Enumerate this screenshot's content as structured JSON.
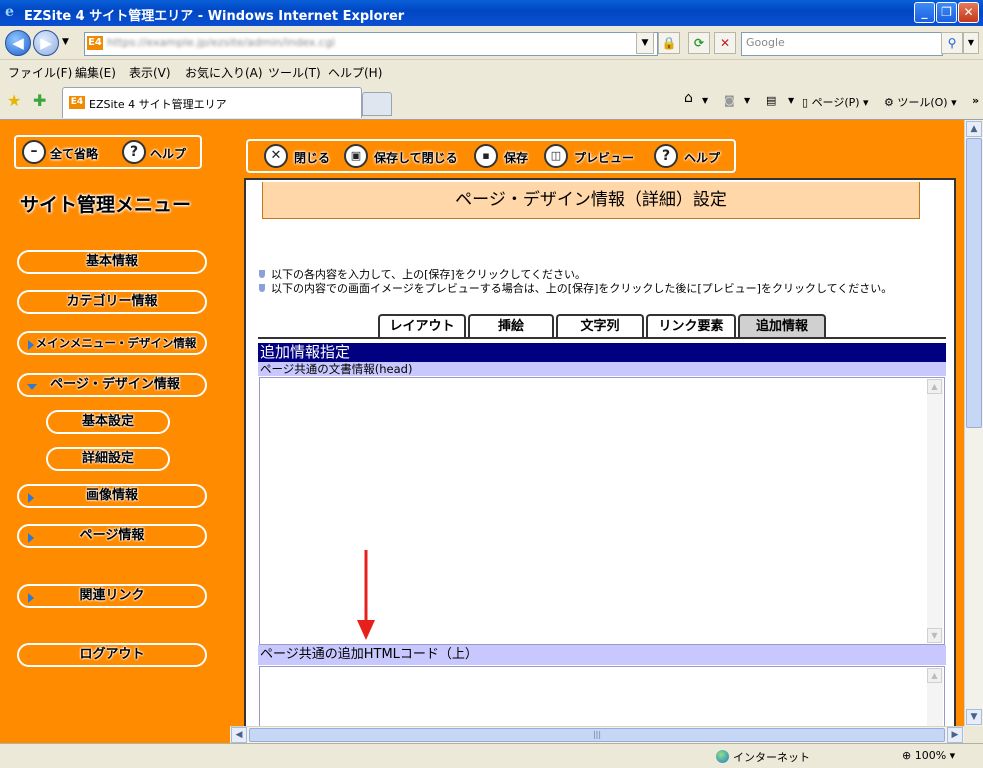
{
  "window": {
    "title": "EZSite 4 サイト管理エリア - Windows Internet Explorer",
    "minimize": "_",
    "restore": "❐",
    "close": "✕"
  },
  "addressbar": {
    "badge": "E4",
    "url": "https://example.jp/ezsite/admin/index.cgi",
    "search_placeholder": "Google"
  },
  "menubar": {
    "items": [
      "ファイル(F)",
      "編集(E)",
      "表示(V)",
      "お気に入り(A)",
      "ツール(T)",
      "ヘルプ(H)"
    ]
  },
  "tabbar": {
    "badge": "E4",
    "active_tab": "EZSite 4 サイト管理エリア",
    "page_cmd": "ページ(P)",
    "tools_cmd": "ツール(O)",
    "chevron": "»"
  },
  "sidebar": {
    "collapse_all": "全て省略",
    "help": "ヘルプ",
    "menu_title": "サイト管理メニュー",
    "items": [
      {
        "label": "基本情報"
      },
      {
        "label": "カテゴリー情報"
      },
      {
        "label": "メインメニュー・デザイン情報"
      },
      {
        "label": "ページ・デザイン情報"
      },
      {
        "label": "基本設定"
      },
      {
        "label": "詳細設定"
      },
      {
        "label": "画像情報"
      },
      {
        "label": "ページ情報"
      },
      {
        "label": "関連リンク"
      },
      {
        "label": "ログアウト"
      }
    ]
  },
  "toolbar": {
    "close": "閉じる",
    "save_close": "保存して閉じる",
    "save": "保存",
    "preview": "プレビュー",
    "help": "ヘルプ"
  },
  "content": {
    "title": "ページ・デザイン情報（詳細）設定",
    "notes": [
      "以下の各内容を入力して、上の[保存]をクリックしてください。",
      "以下の内容での画面イメージをプレビューする場合は、上の[保存]をクリックした後に[プレビュー]をクリックしてください。"
    ],
    "tabs": [
      "レイアウト",
      "挿絵",
      "文字列",
      "リンク要素",
      "追加情報"
    ],
    "active_tab": "追加情報",
    "section_header": "追加情報指定",
    "field1_label": "ページ共通の文書情報(head)",
    "field1_value": "",
    "field2_label": "ページ共通の追加HTMLコード（上）",
    "field2_value": ""
  },
  "statusbar": {
    "zone": "インターネット",
    "zoom": "100%"
  },
  "colors": {
    "page_bg": "#ff8c00",
    "section_header": "#000080",
    "field_label": "#c8c8ff",
    "title_box": "#ffd7a8",
    "annotation_arrow": "#e8201c"
  }
}
